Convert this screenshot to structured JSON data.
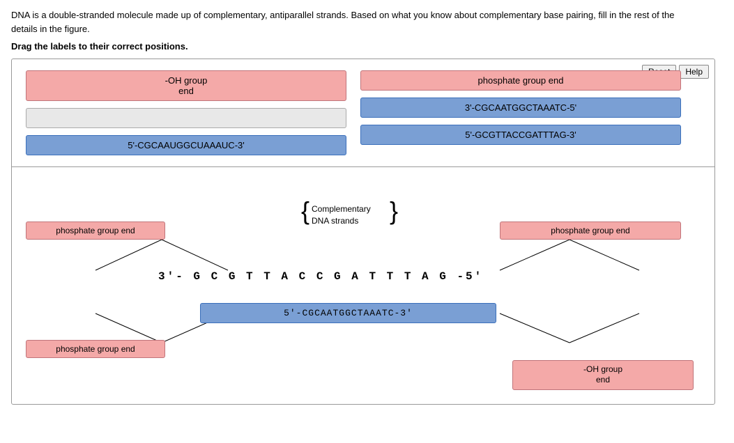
{
  "instructions": {
    "main": "DNA is a double-stranded molecule made up of complementary, antiparallel strands. Based on what you know about complementary base pairing, fill in the rest of the details in the figure.",
    "drag": "Drag the labels to their correct positions."
  },
  "buttons": {
    "reset": "Reset",
    "help": "Help"
  },
  "top_section": {
    "left": {
      "label1": "-OH group\nend",
      "label2": "",
      "label3": "5'-CGCAAUGGCUAAAUC-3'"
    },
    "right": {
      "label1": "phosphate group end",
      "label2": "3'-CGCAATGGCTAAATC-5'",
      "label3": "5'-GCGTTACCGATTTAG-3'"
    }
  },
  "bottom_section": {
    "left_label": "phosphate group end",
    "right_label": "phosphate group end",
    "bottom_left_label": "phosphate group end",
    "bottom_right_label": "-OH group\nend",
    "comp_label": "Complementary\nDNA strands",
    "strand1": "3'- G C G T T A C C G A T T T A G -5'",
    "strand2": "5'-CGCAATGGCTAAATC-3'"
  }
}
